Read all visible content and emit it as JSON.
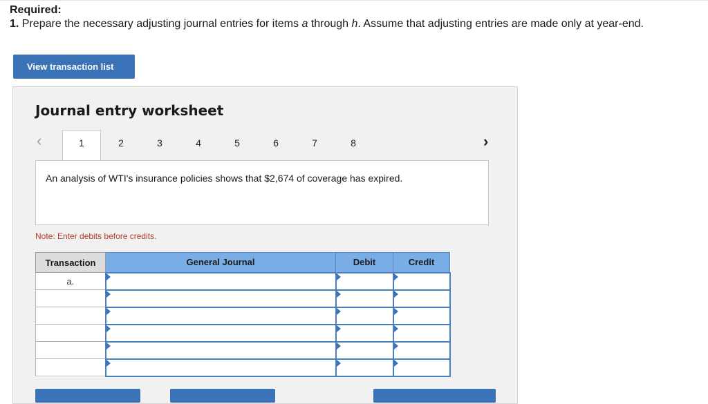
{
  "required": {
    "heading": "Required:",
    "number": "1.",
    "text_before": " Prepare the necessary adjusting journal entries for items ",
    "item_a": "a",
    "text_mid": " through ",
    "item_h": "h",
    "text_after": ". Assume that adjusting entries are made only at year-end."
  },
  "view_button_label": "View transaction list",
  "worksheet": {
    "title": "Journal entry worksheet",
    "prev_icon": "‹",
    "next_icon": "›",
    "tabs": [
      "1",
      "2",
      "3",
      "4",
      "5",
      "6",
      "7",
      "8"
    ],
    "active_tab": "1",
    "description": "An analysis of WTI's insurance policies shows that $2,674 of coverage has expired.",
    "note_label": "Note:",
    "note_text": " Enter debits before credits."
  },
  "journal_table": {
    "headers": [
      "Transaction",
      "General Journal",
      "Debit",
      "Credit"
    ],
    "rows": [
      {
        "transaction": "a.",
        "account": "",
        "debit": "",
        "credit": ""
      },
      {
        "transaction": "",
        "account": "",
        "debit": "",
        "credit": ""
      },
      {
        "transaction": "",
        "account": "",
        "debit": "",
        "credit": ""
      },
      {
        "transaction": "",
        "account": "",
        "debit": "",
        "credit": ""
      },
      {
        "transaction": "",
        "account": "",
        "debit": "",
        "credit": ""
      },
      {
        "transaction": "",
        "account": "",
        "debit": "",
        "credit": ""
      }
    ]
  },
  "colors": {
    "button_blue": "#3b73b9",
    "header_blue": "#7aade6",
    "note_red": "#b03a2e",
    "panel_gray": "#f1f1f1"
  }
}
